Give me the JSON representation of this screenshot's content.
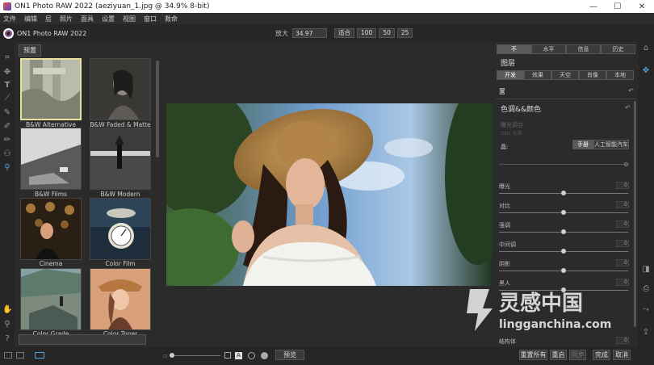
{
  "window": {
    "title": "ON1 Photo RAW 2022 (aeziyuan_1.jpg @ 34.9% 8-bit)"
  },
  "menu": [
    "文件",
    "编辑",
    "层",
    "照片",
    "面具",
    "设置",
    "视图",
    "窗口",
    "救命"
  ],
  "app": {
    "name": "ON1 Photo RAW 2022"
  },
  "zoom": {
    "label": "放大",
    "value": "34.97",
    "buttons": [
      "适合",
      "100",
      "50",
      "25"
    ]
  },
  "presets": {
    "tab": "预置",
    "items": [
      {
        "label": "B&W Alternative"
      },
      {
        "label": "B&W Faded & Matte"
      },
      {
        "label": "B&W Films"
      },
      {
        "label": "B&W Modern"
      },
      {
        "label": "Cinema"
      },
      {
        "label": "Color Film"
      },
      {
        "label": "Color Grade"
      },
      {
        "label": "Color Toner"
      }
    ]
  },
  "right": {
    "top_tabs": [
      "不",
      "水平",
      "信息",
      "历史"
    ],
    "layers_title": "图层",
    "sub_tabs": [
      "开发",
      "效果",
      "天空",
      "肖像",
      "本地"
    ],
    "section_title": "色调&&颜色",
    "faded_line1": "曝光调合",
    "faded_line2": "ON1 标准",
    "mode_label": "晶:",
    "mode_buttons": [
      "手册",
      "人工智能汽车"
    ],
    "sliders": [
      {
        "name": "曝光",
        "value": "0",
        "level": 0.5
      },
      {
        "name": "对比",
        "value": "0",
        "level": 0.5
      },
      {
        "name": "强调",
        "value": "0",
        "level": 0.5
      },
      {
        "name": "中间调",
        "value": "0",
        "level": 0.5
      },
      {
        "name": "阴影",
        "value": "0",
        "level": 0.5
      },
      {
        "name": "黑人",
        "value": "0",
        "level": 0.5
      }
    ],
    "last_slider": {
      "name": "结构体",
      "value": "0"
    }
  },
  "bottom": {
    "preview": "预览",
    "reset_all": "重置所有",
    "reset": "重启",
    "sync": "同步",
    "done": "完成",
    "cancel": "取消"
  },
  "watermark": {
    "text_cn": "灵感中国",
    "text_url": "lingganchina.com"
  }
}
